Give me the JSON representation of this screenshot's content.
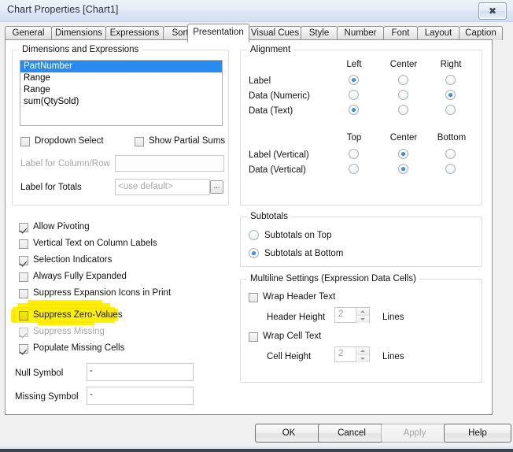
{
  "window": {
    "title": "Chart Properties [Chart1]",
    "close_icon": "close-icon",
    "close_glyph": "✖"
  },
  "tabs": [
    {
      "label": "General",
      "active": false
    },
    {
      "label": "Dimensions",
      "active": false
    },
    {
      "label": "Expressions",
      "active": false
    },
    {
      "label": "Sort",
      "active": false
    },
    {
      "label": "Presentation",
      "active": true
    },
    {
      "label": "Visual Cues",
      "active": false
    },
    {
      "label": "Style",
      "active": false
    },
    {
      "label": "Number",
      "active": false
    },
    {
      "label": "Font",
      "active": false
    },
    {
      "label": "Layout",
      "active": false
    },
    {
      "label": "Caption",
      "active": false
    }
  ],
  "dimensions_group": {
    "title": "Dimensions and Expressions",
    "list": [
      {
        "label": "PartNumber",
        "selected": true
      },
      {
        "label": "Range",
        "selected": false
      },
      {
        "label": "Range",
        "selected": false
      },
      {
        "label": "sum(QtySold)",
        "selected": false
      }
    ],
    "dropdown_select": {
      "label": "Dropdown Select",
      "checked": false
    },
    "show_partial_sums": {
      "label": "Show Partial Sums",
      "checked": false
    },
    "label_for_column_row": {
      "label": "Label for Column/Row",
      "value": "",
      "disabled": true
    },
    "label_for_totals": {
      "label": "Label for Totals",
      "placeholder": "<use default>",
      "value": "",
      "ellipsis": "..."
    }
  },
  "options": {
    "allow_pivoting": {
      "label": "Allow Pivoting",
      "checked": true,
      "disabled": false
    },
    "vertical_text": {
      "label": "Vertical Text on Column Labels",
      "checked": false,
      "disabled": false
    },
    "selection_indicators": {
      "label": "Selection Indicators",
      "checked": true,
      "disabled": false
    },
    "always_fully_expanded": {
      "label": "Always Fully Expanded",
      "checked": false,
      "disabled": false
    },
    "suppress_expansion_icons": {
      "label": "Suppress Expansion Icons in Print",
      "checked": false,
      "disabled": false
    },
    "suppress_zero_values": {
      "label": "Suppress Zero-Values",
      "checked": false,
      "disabled": false,
      "highlighted": true
    },
    "suppress_missing": {
      "label": "Suppress Missing",
      "checked": true,
      "disabled": true
    },
    "populate_missing_cells": {
      "label": "Populate Missing Cells",
      "checked": true,
      "disabled": false
    },
    "null_symbol": {
      "label": "Null Symbol",
      "value": "-"
    },
    "missing_symbol": {
      "label": "Missing Symbol",
      "value": "-"
    }
  },
  "alignment": {
    "title": "Alignment",
    "horizontal_headers": [
      "Left",
      "Center",
      "Right"
    ],
    "vertical_headers": [
      "Top",
      "Center",
      "Bottom"
    ],
    "horizontal_rows": [
      {
        "label": "Label",
        "selected": "Left"
      },
      {
        "label": "Data (Numeric)",
        "selected": "Right"
      },
      {
        "label": "Data (Text)",
        "selected": "Left"
      }
    ],
    "vertical_rows": [
      {
        "label": "Label (Vertical)",
        "selected": "Center"
      },
      {
        "label": "Data (Vertical)",
        "selected": "Center"
      }
    ]
  },
  "subtotals": {
    "title": "Subtotals",
    "options": [
      {
        "label": "Subtotals on Top",
        "selected": false
      },
      {
        "label": "Subtotals at Bottom",
        "selected": true
      }
    ]
  },
  "multiline": {
    "title": "Multiline Settings (Expression Data Cells)",
    "wrap_header_text": {
      "label": "Wrap Header Text",
      "checked": false
    },
    "header_height": {
      "label": "Header Height",
      "value": "2",
      "unit": "Lines"
    },
    "wrap_cell_text": {
      "label": "Wrap Cell Text",
      "checked": false
    },
    "cell_height": {
      "label": "Cell Height",
      "value": "2",
      "unit": "Lines"
    }
  },
  "buttons": [
    {
      "label": "OK",
      "disabled": false
    },
    {
      "label": "Cancel",
      "disabled": false
    },
    {
      "label": "Apply",
      "disabled": true
    },
    {
      "label": "Help",
      "disabled": false
    }
  ],
  "colors": {
    "highlight": "#fff200",
    "selection": "#2a8bef",
    "radio_on": "#0a63c2",
    "titlebar": "#dbe6f4"
  }
}
